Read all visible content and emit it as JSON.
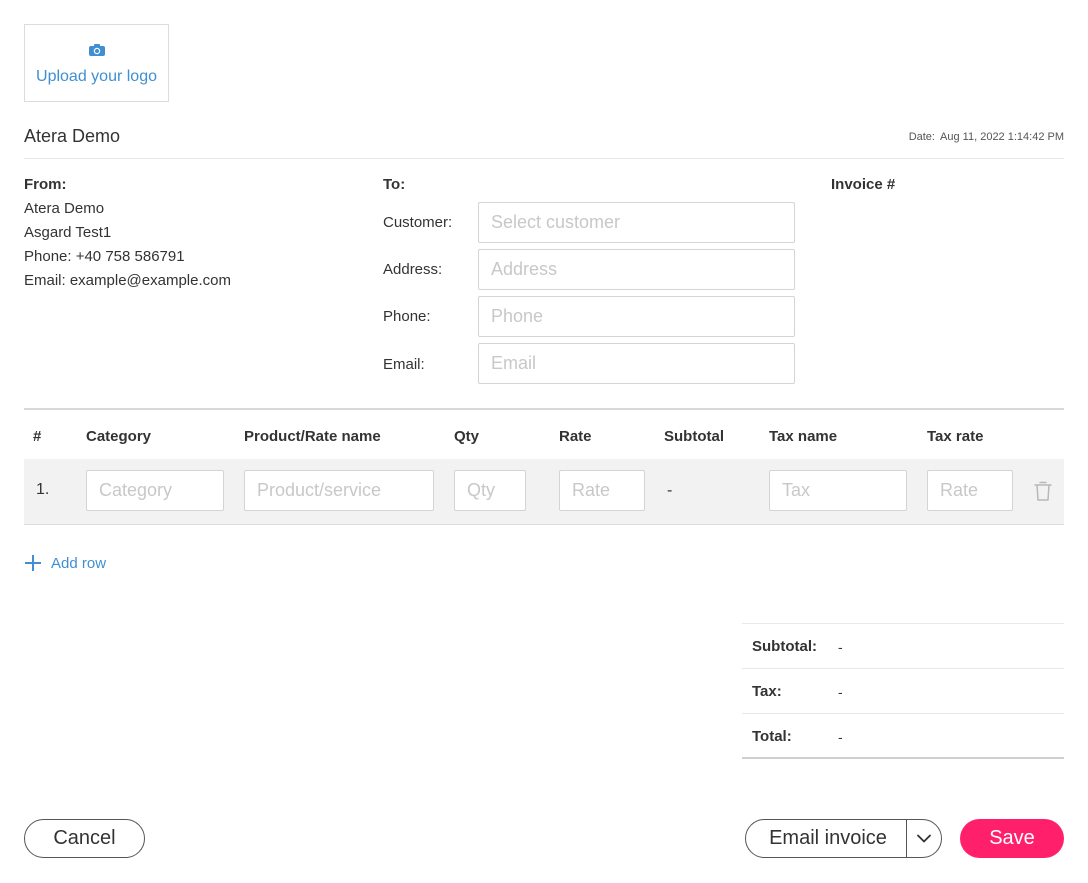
{
  "logo": {
    "upload_label": "Upload your logo",
    "icon": "camera-icon"
  },
  "header": {
    "company_name": "Atera Demo",
    "date_label": "Date:",
    "date_value": "Aug 11, 2022 1:14:42 PM"
  },
  "from": {
    "title": "From:",
    "lines": [
      "Atera Demo",
      "Asgard Test1",
      "Phone: +40 758 586791",
      "Email: example@example.com"
    ]
  },
  "to": {
    "title": "To:",
    "fields": [
      {
        "label": "Customer:",
        "placeholder": "Select customer",
        "value": ""
      },
      {
        "label": "Address:",
        "placeholder": "Address",
        "value": ""
      },
      {
        "label": "Phone:",
        "placeholder": "Phone",
        "value": ""
      },
      {
        "label": "Email:",
        "placeholder": "Email",
        "value": ""
      }
    ]
  },
  "invoice": {
    "number_label": "Invoice #"
  },
  "table": {
    "headers": [
      "#",
      "Category",
      "Product/Rate name",
      "Qty",
      "Rate",
      "Subtotal",
      "Tax name",
      "Tax rate"
    ],
    "rows": [
      {
        "number": "1.",
        "category_placeholder": "Category",
        "product_placeholder": "Product/service",
        "qty_placeholder": "Qty",
        "rate_placeholder": "Rate",
        "subtotal": "-",
        "tax_placeholder": "Tax",
        "tax_rate_placeholder": "Rate"
      }
    ],
    "add_row_label": "Add row"
  },
  "summary": {
    "subtotal_label": "Subtotal:",
    "subtotal_value": "-",
    "tax_label": "Tax:",
    "tax_value": "-",
    "total_label": "Total:",
    "total_value": "-"
  },
  "actions": {
    "cancel_label": "Cancel",
    "email_label": "Email invoice",
    "save_label": "Save"
  },
  "colors": {
    "accent_blue": "#3f8fd2",
    "save_pink": "#ff1f6b",
    "row_bg": "#f2f2f2"
  }
}
